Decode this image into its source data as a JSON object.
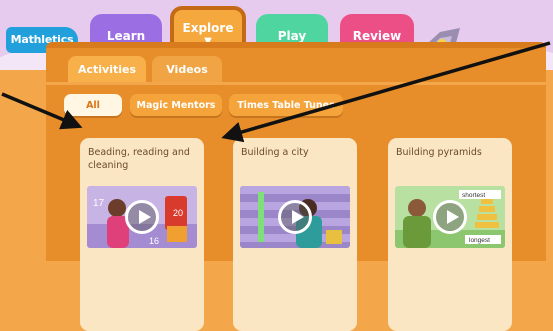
{
  "header": {
    "logo_text": "Mathletics",
    "nav": [
      {
        "label": "Learn"
      },
      {
        "label": "Explore"
      },
      {
        "label": "Play"
      },
      {
        "label": "Review"
      }
    ]
  },
  "tabs": [
    {
      "label": "Activities"
    },
    {
      "label": "Videos"
    }
  ],
  "filters": [
    {
      "label": "All"
    },
    {
      "label": "Magic Mentors"
    },
    {
      "label": "Times Table Tunes"
    }
  ],
  "videos": [
    {
      "title": "Beading, reading and cleaning"
    },
    {
      "title": "Building a city"
    },
    {
      "title": "Building pyramids"
    }
  ],
  "thumb_text": {
    "n17": "17",
    "n20": "20",
    "n16": "16",
    "shortest": "shortest",
    "longest": "longest"
  },
  "colors": {
    "header_bg": "#e6cbee",
    "learn": "#9b6fe3",
    "explore": "#f4a83e",
    "play": "#4fd6a0",
    "review": "#ec4f86",
    "logo": "#21a0dc",
    "panel": "#e78e2b",
    "arrow": "#111111"
  }
}
